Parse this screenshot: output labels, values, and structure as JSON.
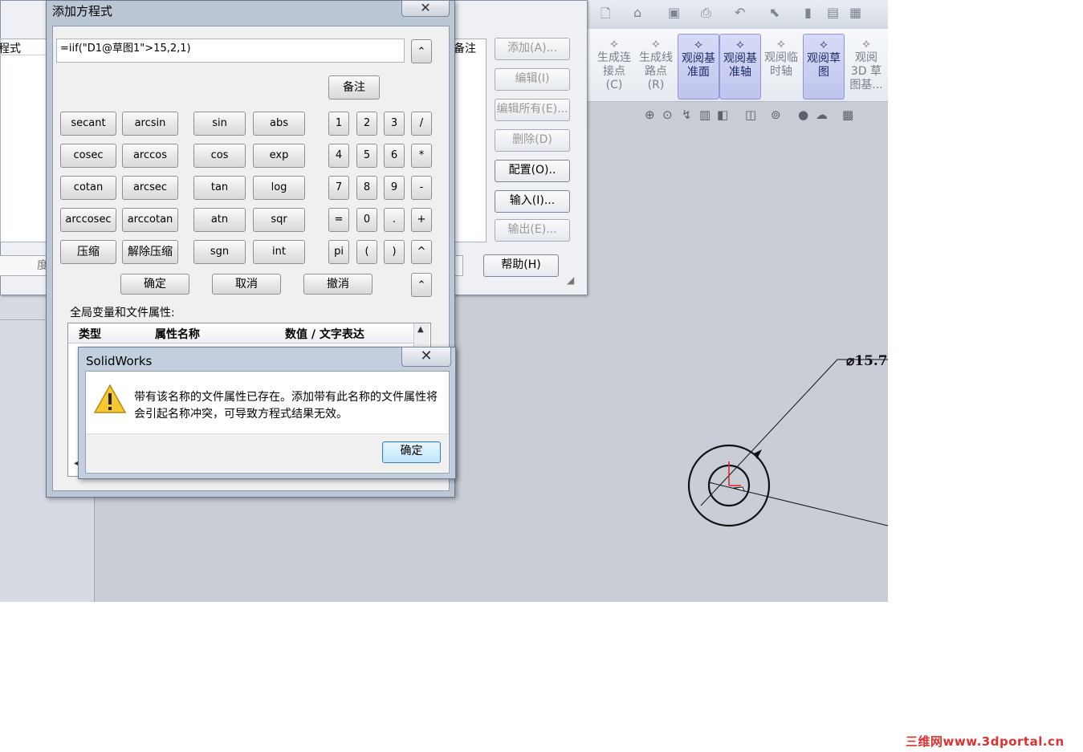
{
  "toolbar": {
    "icons": [
      "new-doc-icon",
      "open-icon",
      "save-icon",
      "print-icon",
      "undo-icon",
      "select-icon",
      "rebuild-icon",
      "file-props-icon",
      "options-icon"
    ]
  },
  "ribbon": {
    "items": [
      {
        "label1": "生成连",
        "label2": "接点",
        "label3": "(C)",
        "active": false,
        "icon": "point-icon"
      },
      {
        "label1": "生成线",
        "label2": "路点",
        "label3": "(R)",
        "active": false,
        "icon": "route-point-icon"
      },
      {
        "label1": "观阅基",
        "label2": "准面",
        "label3": "",
        "active": true,
        "icon": "plane-icon"
      },
      {
        "label1": "观阅基",
        "label2": "准轴",
        "label3": "",
        "active": true,
        "icon": "axis-icon"
      },
      {
        "label1": "观阅临",
        "label2": "时轴",
        "label3": "",
        "active": false,
        "icon": "temp-axis-icon"
      },
      {
        "label1": "观阅草",
        "label2": "图",
        "label3": "",
        "active": true,
        "icon": "sketch-icon"
      },
      {
        "label1": "观阅",
        "label2": "3D 草",
        "label3": "图基...",
        "active": false,
        "icon": "3d-sketch-icon"
      }
    ]
  },
  "equations_dialog": {
    "column_equation": "程式",
    "column_note": "备注",
    "buttons": {
      "add": "添加(A)...",
      "edit": "编辑(I)",
      "edit_all": "编辑所有(E)...",
      "delete": "删除(D)",
      "config": "配置(O)..",
      "import": "输入(I)...",
      "export": "输出(E)...",
      "help": "帮助(H)"
    },
    "clipped_char": "度"
  },
  "add_equation_dialog": {
    "title": "添加方程式",
    "close": "✕",
    "equation": "=iif(\"D1@草图1\">15,2,1)",
    "note_button": "备注",
    "collapse_up": "⌃",
    "functions": [
      [
        "secant",
        "arcsin",
        "sin",
        "abs"
      ],
      [
        "cosec",
        "arccos",
        "cos",
        "exp"
      ],
      [
        "cotan",
        "arcsec",
        "tan",
        "log"
      ],
      [
        "arccosec",
        "arccotan",
        "atn",
        "sqr"
      ],
      [
        "压缩",
        "解除压缩",
        "sgn",
        "int"
      ]
    ],
    "keypad": [
      [
        "1",
        "2",
        "3",
        "/"
      ],
      [
        "4",
        "5",
        "6",
        "*"
      ],
      [
        "7",
        "8",
        "9",
        "-"
      ],
      [
        "=",
        "0",
        ".",
        "+"
      ],
      [
        "pi",
        "(",
        ")",
        "^"
      ]
    ],
    "ok": "确定",
    "cancel": "取消",
    "undo": "撤消",
    "globals_label": "全局变量和文件属性:",
    "table_headers": {
      "type": "类型",
      "name": "属性名称",
      "value": "数值 / 文字表达"
    }
  },
  "message_box": {
    "title": "SolidWorks",
    "close": "✕",
    "text": "带有该名称的文件属性已存在。添加带有此名称的文件属性将会引起名称冲突，可导致方程式结果无效。",
    "ok": "确定"
  },
  "drawing": {
    "dimension": "⌀15.7"
  },
  "watermark": "三维网www.3dportal.cn"
}
